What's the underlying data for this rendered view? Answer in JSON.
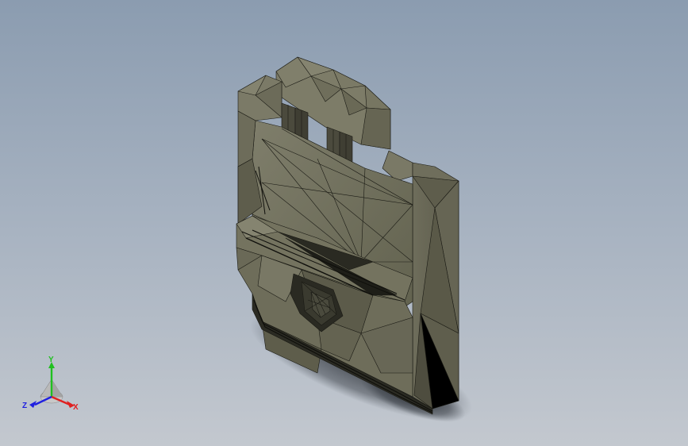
{
  "viewport": {
    "background_top": "#8b9cb0",
    "background_bottom": "#c3c8cf",
    "model_face_light": "#7c7b68",
    "model_face_mid": "#6a6a58",
    "model_face_dark": "#4a4a3c",
    "mesh_line_color": "#1a1a14"
  },
  "triad": {
    "x_label": "X",
    "y_label": "Y",
    "z_label": "Z",
    "x_color": "#e02020",
    "y_color": "#20c020",
    "z_color": "#2020e0"
  }
}
